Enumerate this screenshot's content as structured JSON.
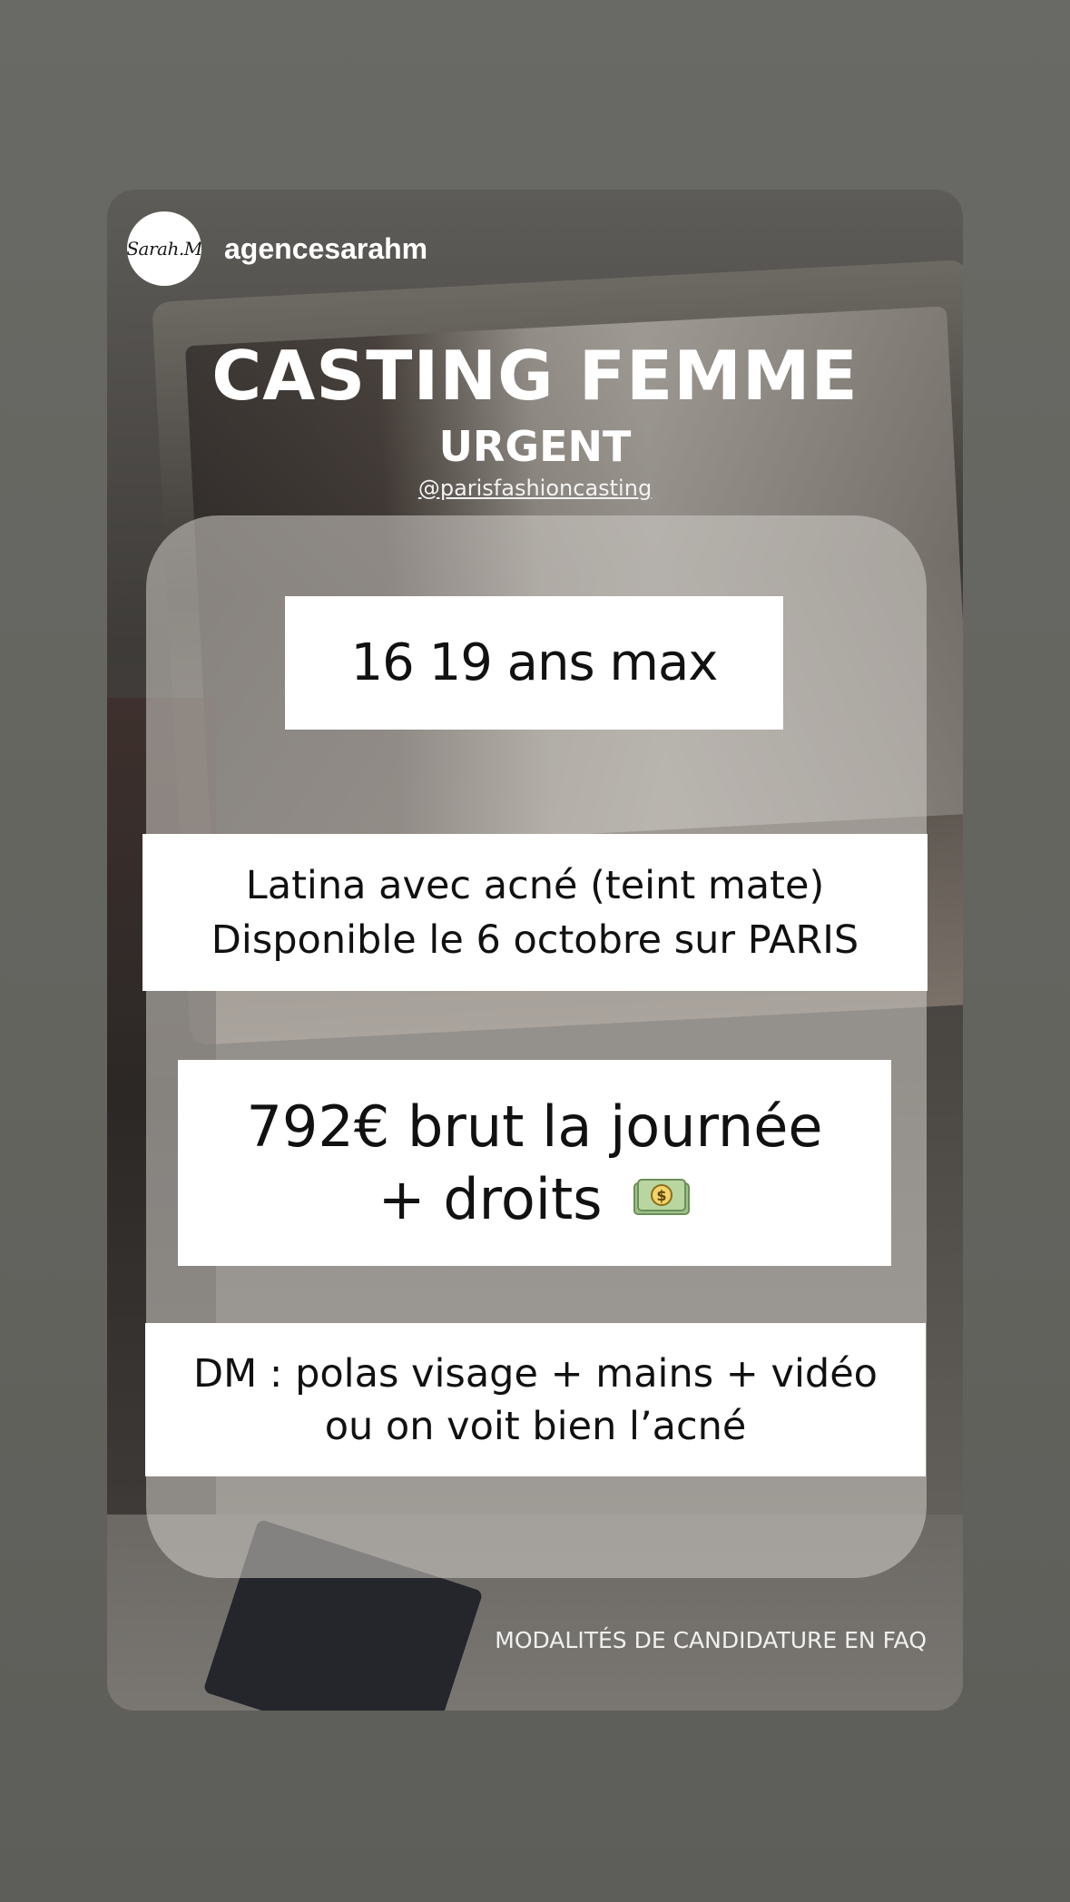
{
  "header": {
    "avatar_text": "Sarah.M",
    "username": "agencesarahm"
  },
  "post": {
    "title": "CASTING FEMME",
    "subtitle": "URGENT",
    "handle": "@parisfashioncasting",
    "age": "16 19 ans max",
    "profile_line1": "Latina avec acné (teint mate)",
    "profile_line2": "Disponible le 6 octobre sur PARIS",
    "pay_line1": "792€ brut la journée",
    "pay_line2": "+ droits",
    "pay_icon": "money-bill-icon",
    "dm_line1": "DM : polas visage + mains + vidéo",
    "dm_line2": "ou on voit bien l’acné",
    "footer": "MODALITÉS DE CANDIDATURE EN FAQ"
  }
}
